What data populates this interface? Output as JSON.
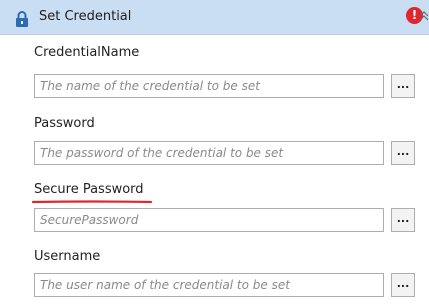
{
  "header": {
    "title": "Set Credential",
    "icons": {
      "lock": "lock-icon",
      "error": "error-icon",
      "collapse": "chevron-up-icon"
    },
    "error_glyph": "!"
  },
  "fields": [
    {
      "label": "CredentialName",
      "placeholder": "The name of the credential to be set",
      "browse": "..."
    },
    {
      "label": "Password",
      "placeholder": "The password of the credential to be set",
      "browse": "..."
    },
    {
      "label": "Secure Password",
      "placeholder": "SecurePassword",
      "browse": "..."
    },
    {
      "label": "Username",
      "placeholder": "The user name of the credential to be set",
      "browse": "..."
    }
  ],
  "colors": {
    "header_bg": "#c9def3",
    "lock": "#2d6bb3",
    "error": "#e0262e",
    "annotation_underline": "#e0262e"
  }
}
